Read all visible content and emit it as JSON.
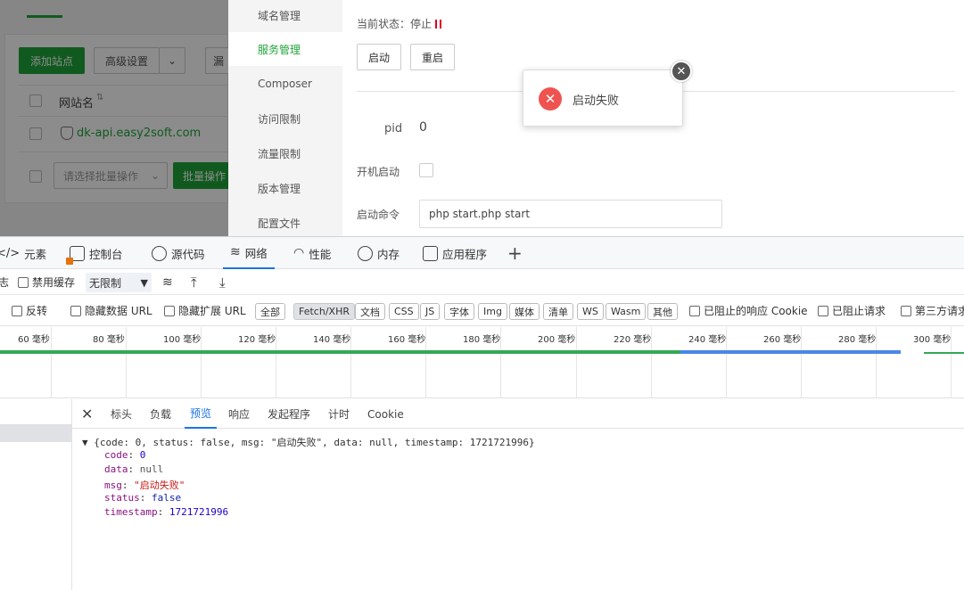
{
  "app": {
    "left_panel": {
      "add_site": "添加站点",
      "advanced": "高级设置",
      "partial_button": "漏",
      "col_site_name": "网站名",
      "site_domain": "dk-api.easy2soft.com",
      "batch_select_placeholder": "请选择批量操作",
      "batch_button": "批量操作"
    },
    "nav": [
      {
        "label": "域名管理"
      },
      {
        "label": "服务管理"
      },
      {
        "label": "Composer"
      },
      {
        "label": "访问限制"
      },
      {
        "label": "流量限制"
      },
      {
        "label": "版本管理"
      },
      {
        "label": "配置文件"
      }
    ],
    "main": {
      "status_label": "当前状态：停止",
      "start_button": "启动",
      "restart_button": "重启",
      "pid_label": "pid",
      "pid_value": "0",
      "autostart_label": "开机启动",
      "cmd_label": "启动命令",
      "cmd_value": "php start.php start"
    },
    "toast": {
      "message": "启动失败"
    },
    "colors": {
      "brand": "#20a53a",
      "error": "#ef5350"
    }
  },
  "devtools": {
    "tabs": [
      {
        "label": "元素",
        "icon": "code-icon"
      },
      {
        "label": "控制台",
        "icon": "console-icon"
      },
      {
        "label": "源代码",
        "icon": "bug-icon"
      },
      {
        "label": "网络",
        "icon": "wifi-icon"
      },
      {
        "label": "性能",
        "icon": "gauge-icon"
      },
      {
        "label": "内存",
        "icon": "memory-icon"
      },
      {
        "label": "应用程序",
        "icon": "app-icon"
      }
    ],
    "toolbar2": {
      "left_cut": "志",
      "disable_cache": "禁用缓存",
      "throttle": "无限制"
    },
    "toolbar3": {
      "invert": "反转",
      "hide_data_url": "隐藏数据 URL",
      "hide_ext_url": "隐藏扩展 URL",
      "filters": [
        "全部",
        "Fetch/XHR",
        "文档",
        "CSS",
        "JS",
        "字体",
        "Img",
        "媒体",
        "清单",
        "WS",
        "Wasm",
        "其他"
      ],
      "blocked_cookies": "已阻止的响应 Cookie",
      "blocked_requests": "已阻止请求",
      "third_party": "第三方请求"
    },
    "timeline_ticks": [
      "60 毫秒",
      "80 毫秒",
      "100 毫秒",
      "120 毫秒",
      "140 毫秒",
      "160 毫秒",
      "180 毫秒",
      "200 毫秒",
      "220 毫秒",
      "240 毫秒",
      "260 毫秒",
      "280 毫秒",
      "300 毫秒"
    ],
    "detail_tabs": [
      "标头",
      "负载",
      "预览",
      "响应",
      "发起程序",
      "计时",
      "Cookie"
    ],
    "preview": {
      "summary": "{code: 0, status: false, msg: \"启动失败\", data: null, timestamp: 1721721996}",
      "code_key": "code",
      "code_val": "0",
      "data_key": "data",
      "data_val": "null",
      "msg_key": "msg",
      "msg_val": "\"启动失败\"",
      "status_key": "status",
      "status_val": "false",
      "ts_key": "timestamp",
      "ts_val": "1721721996"
    }
  }
}
